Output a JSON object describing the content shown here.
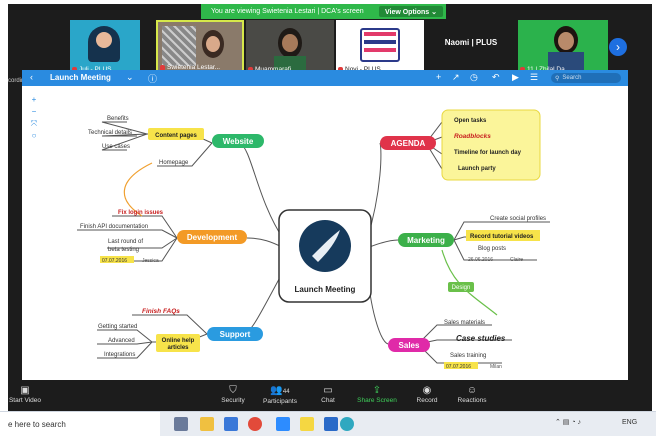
{
  "banner": {
    "text": "You are viewing Swietenia Lestari | DCA's screen",
    "options": "View Options ⌄"
  },
  "participants": [
    {
      "name": "Juli - PLUS"
    },
    {
      "name": "Swietenia Lestar..."
    },
    {
      "name": "Muammarafi..."
    },
    {
      "name": "Novi - PLUS"
    },
    {
      "name": "Naomi | PLUS"
    },
    {
      "name": "11 | Zhilal Da..."
    }
  ],
  "recording_label": "cording",
  "mindmap": {
    "title": "Launch Meeting",
    "search_placeholder": "Search",
    "center": "Launch Meeting",
    "branches": {
      "website": {
        "label": "Website",
        "content_pages": "Content pages",
        "benefits": "Benefits",
        "technical": "Technical details",
        "use_cases": "Use cases",
        "homepage": "Homepage"
      },
      "agenda": {
        "label": "AGENDA",
        "open_tasks": "Open tasks",
        "roadblocks": "Roadblocks",
        "timeline": "Timeline for launch day",
        "launch_party": "Launch party"
      },
      "development": {
        "label": "Development",
        "login": "Fix login issues",
        "api": "Finish API documentation",
        "beta1": "Last round of",
        "beta2": "beta testing",
        "date": "07.07.2016",
        "owner": "Jessica"
      },
      "marketing": {
        "label": "Marketing",
        "social": "Create social profiles",
        "video": "Record tutorial videos",
        "blog": "Blog posts",
        "date": "26.06.2016",
        "owner": "Claire"
      },
      "support": {
        "label": "Support",
        "faq": "Finish FAQs",
        "getting": "Getting started",
        "advanced": "Advanced",
        "integrations": "Integrations",
        "help1": "Online help",
        "help2": "articles"
      },
      "sales": {
        "label": "Sales",
        "materials": "Sales materials",
        "case": "Case studies",
        "training": "Sales training",
        "date": "07.07.2016",
        "owner": "Milan"
      }
    },
    "design_link": "Design"
  },
  "toolbar": {
    "start_video": "Start Video",
    "security": "Security",
    "participants": "Participants",
    "participants_count": "44",
    "chat": "Chat",
    "share": "Share Screen",
    "record": "Record",
    "reactions": "Reactions"
  },
  "taskbar": {
    "search": "e here to search",
    "lang": "ENG"
  }
}
